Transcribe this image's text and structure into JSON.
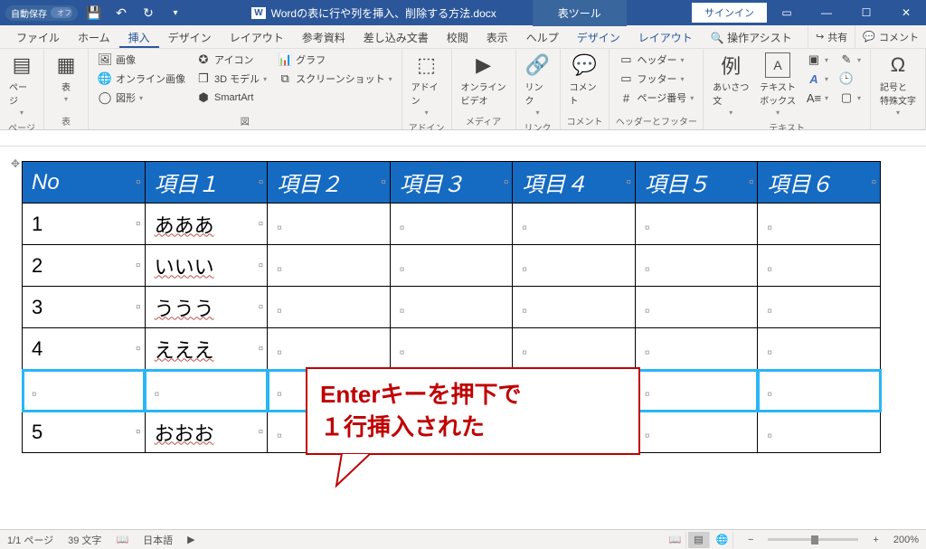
{
  "titlebar": {
    "autosave_label": "自動保存",
    "autosave_state": "オフ",
    "doc_title": "Wordの表に行や列を挿入、削除する方法.docx",
    "tools_tab": "表ツール",
    "signin": "サインイン"
  },
  "menu": {
    "items": [
      "ファイル",
      "ホーム",
      "挿入",
      "デザイン",
      "レイアウト",
      "参考資料",
      "差し込み文書",
      "校閲",
      "表示",
      "ヘルプ",
      "デザイン",
      "レイアウト"
    ],
    "active_index": 2,
    "tell_me": "操作アシスト",
    "share": "共有",
    "comment": "コメント"
  },
  "ribbon": {
    "page": {
      "label": "ページ",
      "btn": "ページ"
    },
    "table": {
      "label": "表",
      "btn": "表"
    },
    "illustrations": {
      "label": "図",
      "image": "画像",
      "online_image": "オンライン画像",
      "shapes": "図形",
      "icons": "アイコン",
      "models": "3D モデル",
      "smartart": "SmartArt",
      "chart": "グラフ",
      "screenshot": "スクリーンショット"
    },
    "addins": {
      "label": "アドイン",
      "btn": "アドイン"
    },
    "media": {
      "label": "メディア",
      "btn": "オンライン\nビデオ"
    },
    "links": {
      "label": "リンク",
      "btn": "リンク"
    },
    "comments": {
      "label": "コメント",
      "btn": "コメント"
    },
    "headerfooter": {
      "label": "ヘッダーとフッター",
      "header": "ヘッダー",
      "footer": "フッター",
      "pageno": "ページ番号"
    },
    "text": {
      "label": "テキスト",
      "greeting": "あいさつ\n文",
      "textbox": "テキスト\nボックス"
    },
    "symbols": {
      "label": "記号と\n特殊文字",
      "btn": "記号と\n特殊文字"
    }
  },
  "table": {
    "headers": [
      "No",
      "項目１",
      "項目２",
      "項目３",
      "項目４",
      "項目５",
      "項目６"
    ],
    "rows": [
      {
        "no": "1",
        "v1": "あああ"
      },
      {
        "no": "2",
        "v1": "いいい"
      },
      {
        "no": "3",
        "v1": "ううう"
      },
      {
        "no": "4",
        "v1": "えええ"
      },
      {
        "no": "",
        "v1": ""
      },
      {
        "no": "5",
        "v1": "おおお"
      }
    ],
    "highlighted_row_index": 4
  },
  "callout": {
    "line1": "Enterキーを押下で",
    "line2": "１行挿入された"
  },
  "status": {
    "page": "1/1 ページ",
    "words": "39 文字",
    "lang": "日本語",
    "zoom": "200%"
  }
}
